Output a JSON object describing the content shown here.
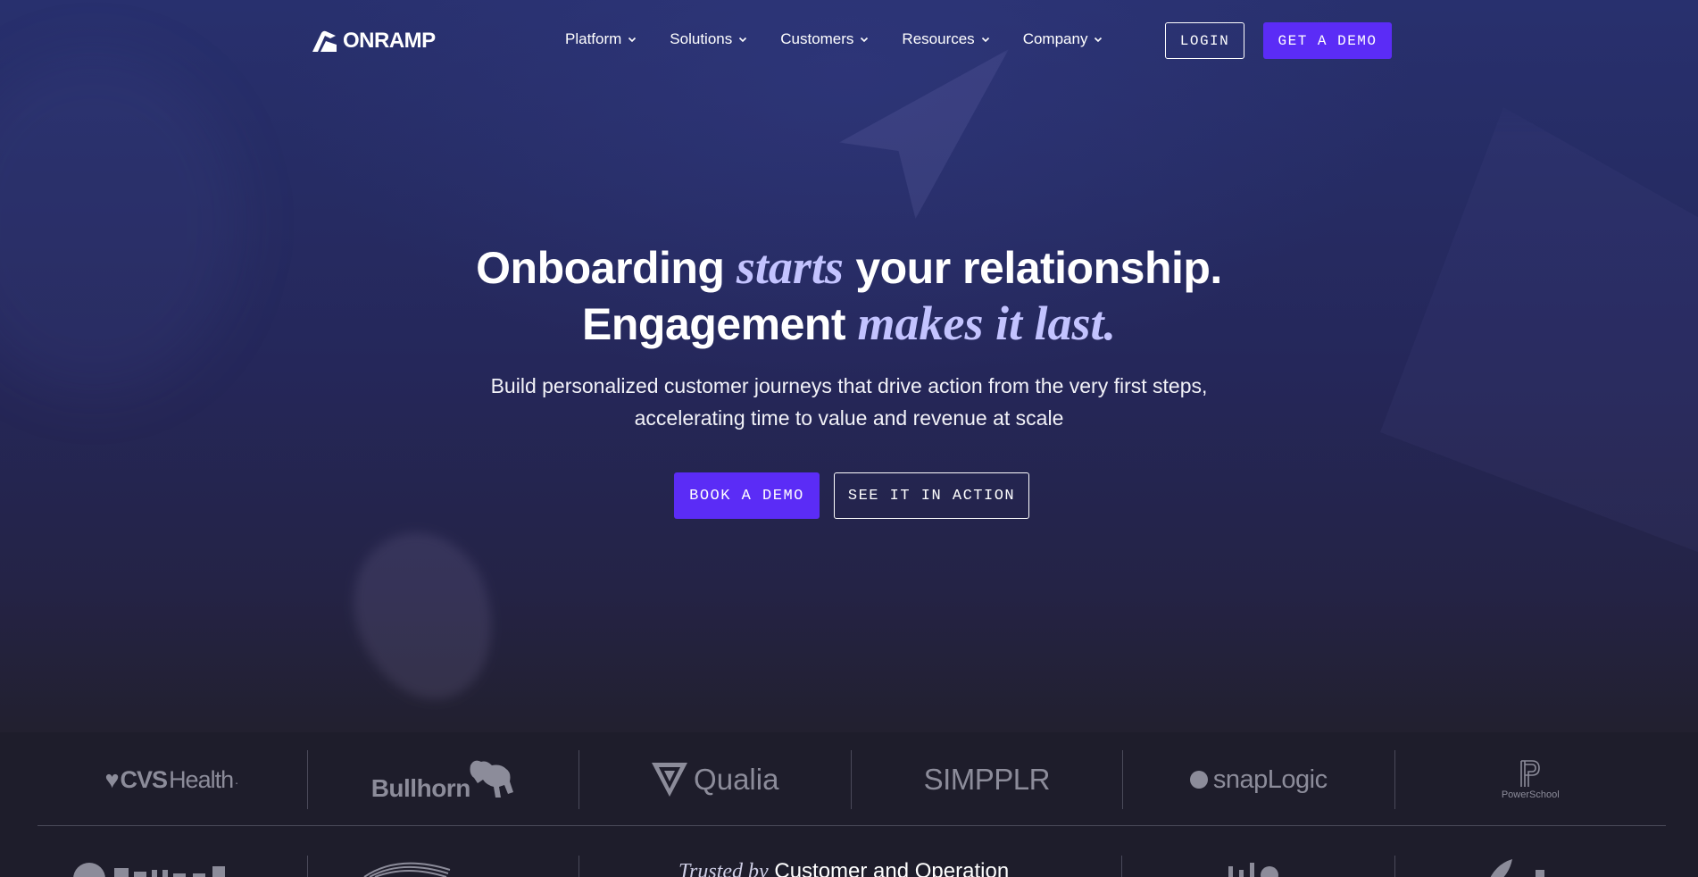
{
  "brand": {
    "name": "ONRAMP",
    "accent_color": "#5b2cf6",
    "headline_accent_color": "#c3c3ff"
  },
  "nav": {
    "menu": [
      {
        "label": "Platform",
        "icon": "chevron-down-icon"
      },
      {
        "label": "Solutions",
        "icon": "chevron-down-icon"
      },
      {
        "label": "Customers",
        "icon": "chevron-down-icon"
      },
      {
        "label": "Resources",
        "icon": "chevron-down-icon"
      },
      {
        "label": "Company",
        "icon": "chevron-down-icon"
      }
    ],
    "login_label": "LOGIN",
    "demo_label": "GET A DEMO"
  },
  "hero": {
    "line1_start": "Onboarding ",
    "line1_italic": "starts",
    "line1_end": " your relationship.",
    "line2_start": "Engagement ",
    "line2_italic": "makes it last.",
    "sub_line1": "Build personalized customer journeys that drive action from the very first steps,",
    "sub_line2": "accelerating time to value and revenue at scale",
    "primary_cta": "BOOK A DEMO",
    "secondary_cta": "SEE IT IN ACTION"
  },
  "customer_logos": {
    "cvs_heart": "♥",
    "cvs_bold": "CVS",
    "cvs_rest": "Health",
    "cvs_mark": ".",
    "bullhorn": "Bullhorn",
    "qualia": "Qualia",
    "simpplr": "SIMPPLR",
    "snaplogic": "snapLogic",
    "powerschool": "PowerSchool"
  },
  "trusted": {
    "italic": "Trusted by",
    "rest": " Customer and Operation"
  }
}
